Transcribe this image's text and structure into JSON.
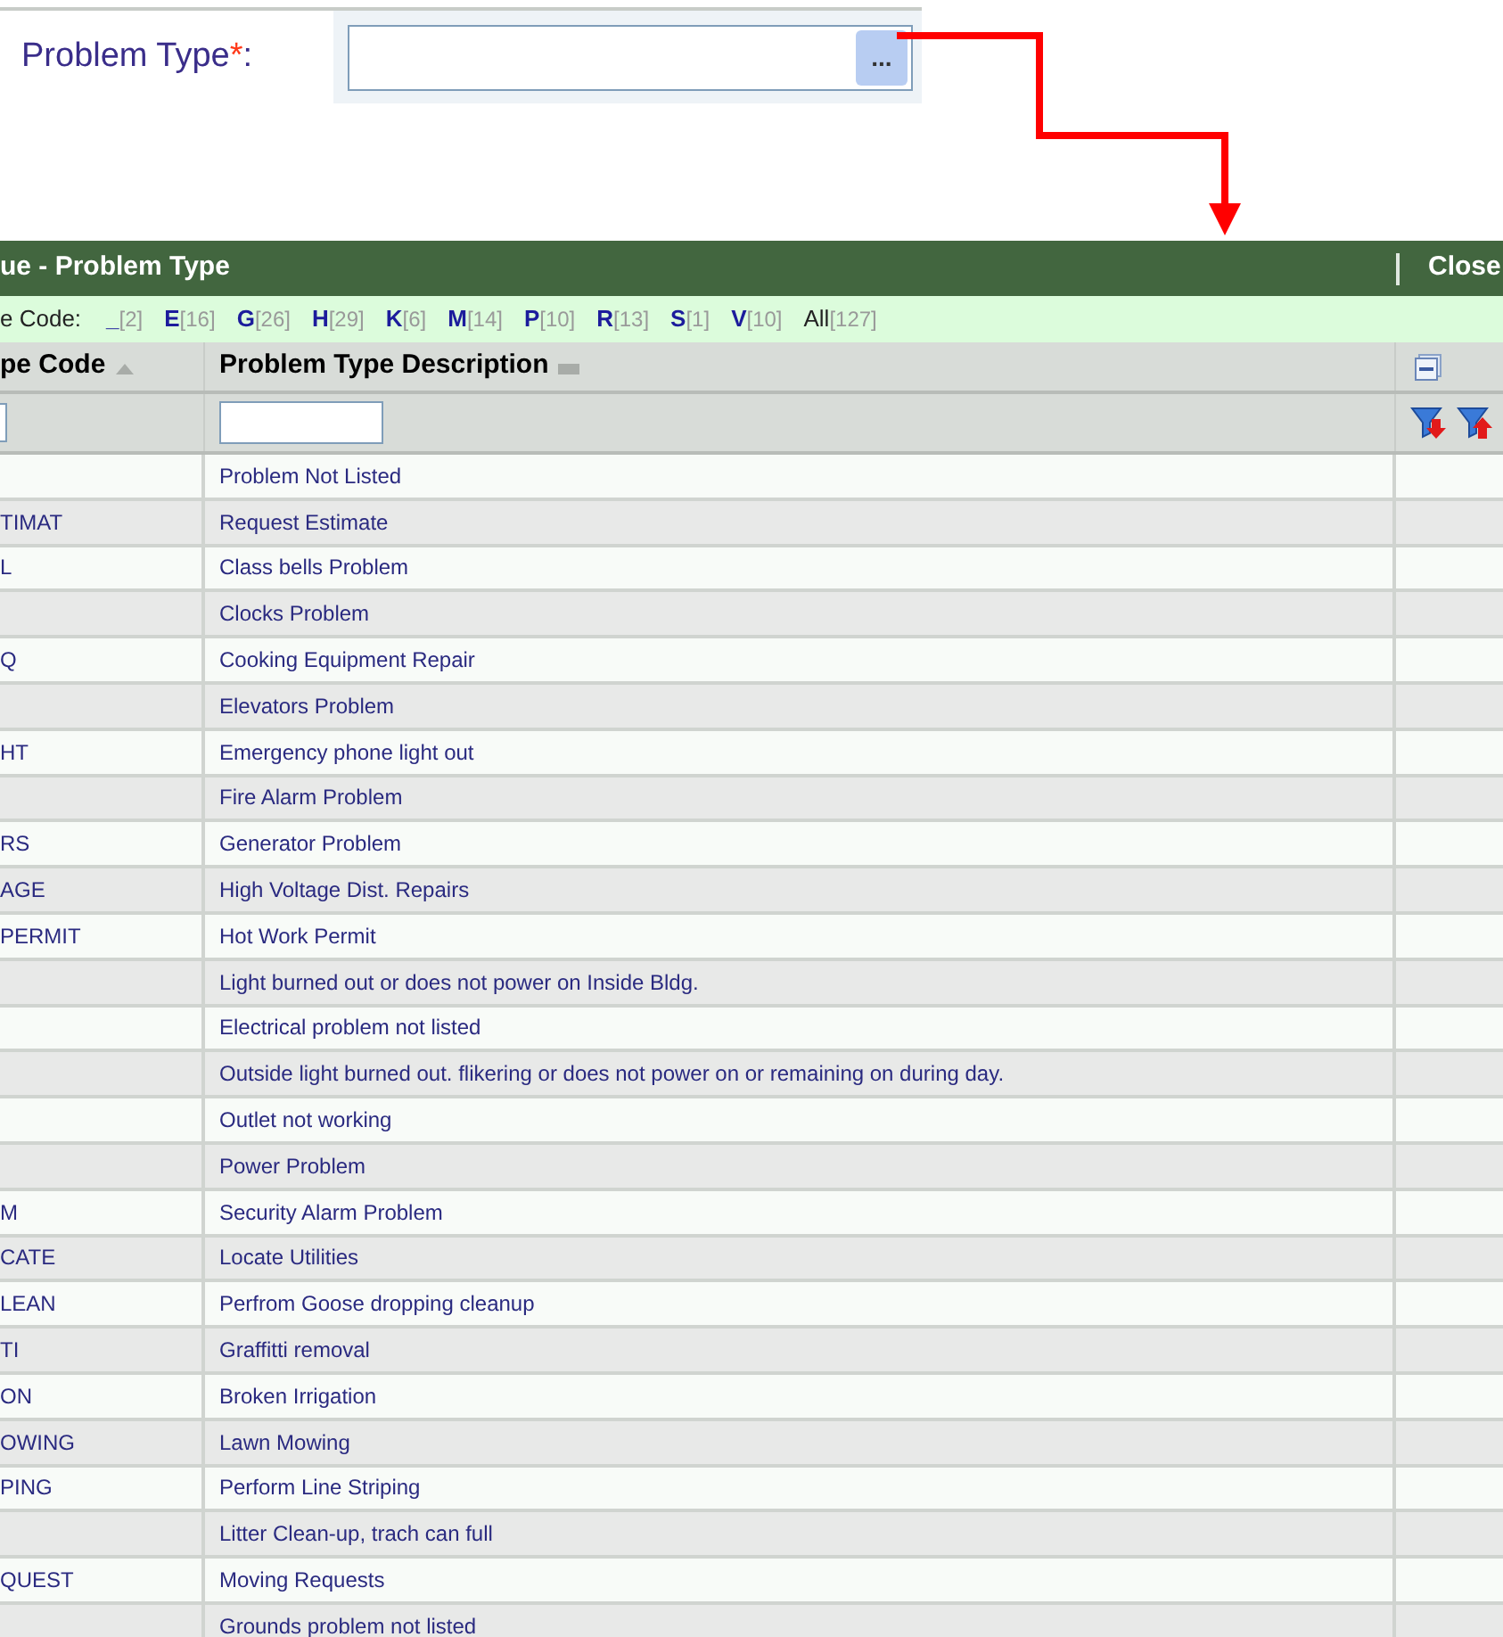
{
  "field": {
    "label": "Problem Type",
    "required_mark": "*",
    "colon": ":",
    "button": "..."
  },
  "dialog": {
    "title": "ue - Problem Type",
    "close": "Close",
    "filter_label": "e Code:",
    "letter_filters": [
      {
        "kind": "letter",
        "letter": "_",
        "count": "[2]"
      },
      {
        "kind": "letter",
        "letter": "E",
        "count": "[16]"
      },
      {
        "kind": "letter",
        "letter": "G",
        "count": "[26]"
      },
      {
        "kind": "letter",
        "letter": "H",
        "count": "[29]"
      },
      {
        "kind": "letter",
        "letter": "K",
        "count": "[6]"
      },
      {
        "kind": "letter",
        "letter": "M",
        "count": "[14]"
      },
      {
        "kind": "letter",
        "letter": "P",
        "count": "[10]"
      },
      {
        "kind": "letter",
        "letter": "R",
        "count": "[13]"
      },
      {
        "kind": "letter",
        "letter": "S",
        "count": "[1]"
      },
      {
        "kind": "letter",
        "letter": "V",
        "count": "[10]"
      },
      {
        "kind": "all",
        "letter": "All",
        "count": "[127]"
      }
    ],
    "columns": [
      {
        "label": "pe Code",
        "sorted": true
      },
      {
        "label": "Problem Type Description",
        "sorted": false
      }
    ],
    "rows": [
      {
        "description": "Problem Not Listed"
      },
      {
        "code": "TIMAT",
        "description": "Request Estimate"
      },
      {
        "code": "L",
        "description": "Class bells Problem"
      },
      {
        "description": "Clocks Problem"
      },
      {
        "code": "Q",
        "description": "Cooking Equipment Repair"
      },
      {
        "description": "Elevators Problem"
      },
      {
        "code": "HT",
        "description": "Emergency phone light out"
      },
      {
        "description": "Fire Alarm Problem"
      },
      {
        "code": "RS",
        "description": "Generator Problem"
      },
      {
        "code": "AGE",
        "description": "High Voltage Dist. Repairs"
      },
      {
        "code": "PERMIT",
        "description": "Hot Work Permit"
      },
      {
        "description": "Light burned out or does not power on Inside Bldg."
      },
      {
        "description": "Electrical problem not listed"
      },
      {
        "description": "Outside light burned out. flikering or does not power on or remaining on during day."
      },
      {
        "description": "Outlet not working"
      },
      {
        "description": "Power Problem"
      },
      {
        "code": "M",
        "description": "Security Alarm Problem"
      },
      {
        "code": "CATE",
        "description": "Locate Utilities"
      },
      {
        "code": "LEAN",
        "description": "Perfrom Goose dropping cleanup"
      },
      {
        "code": "TI",
        "description": "Graffitti removal"
      },
      {
        "code": "ON",
        "description": "Broken Irrigation"
      },
      {
        "code": "OWING",
        "description": "Lawn Mowing"
      },
      {
        "code": "PING",
        "description": "Perform Line Striping"
      },
      {
        "description": "Litter Clean-up, trach can full"
      },
      {
        "code": "QUEST",
        "description": "Moving Requests"
      },
      {
        "description": "Grounds problem not listed"
      }
    ]
  }
}
